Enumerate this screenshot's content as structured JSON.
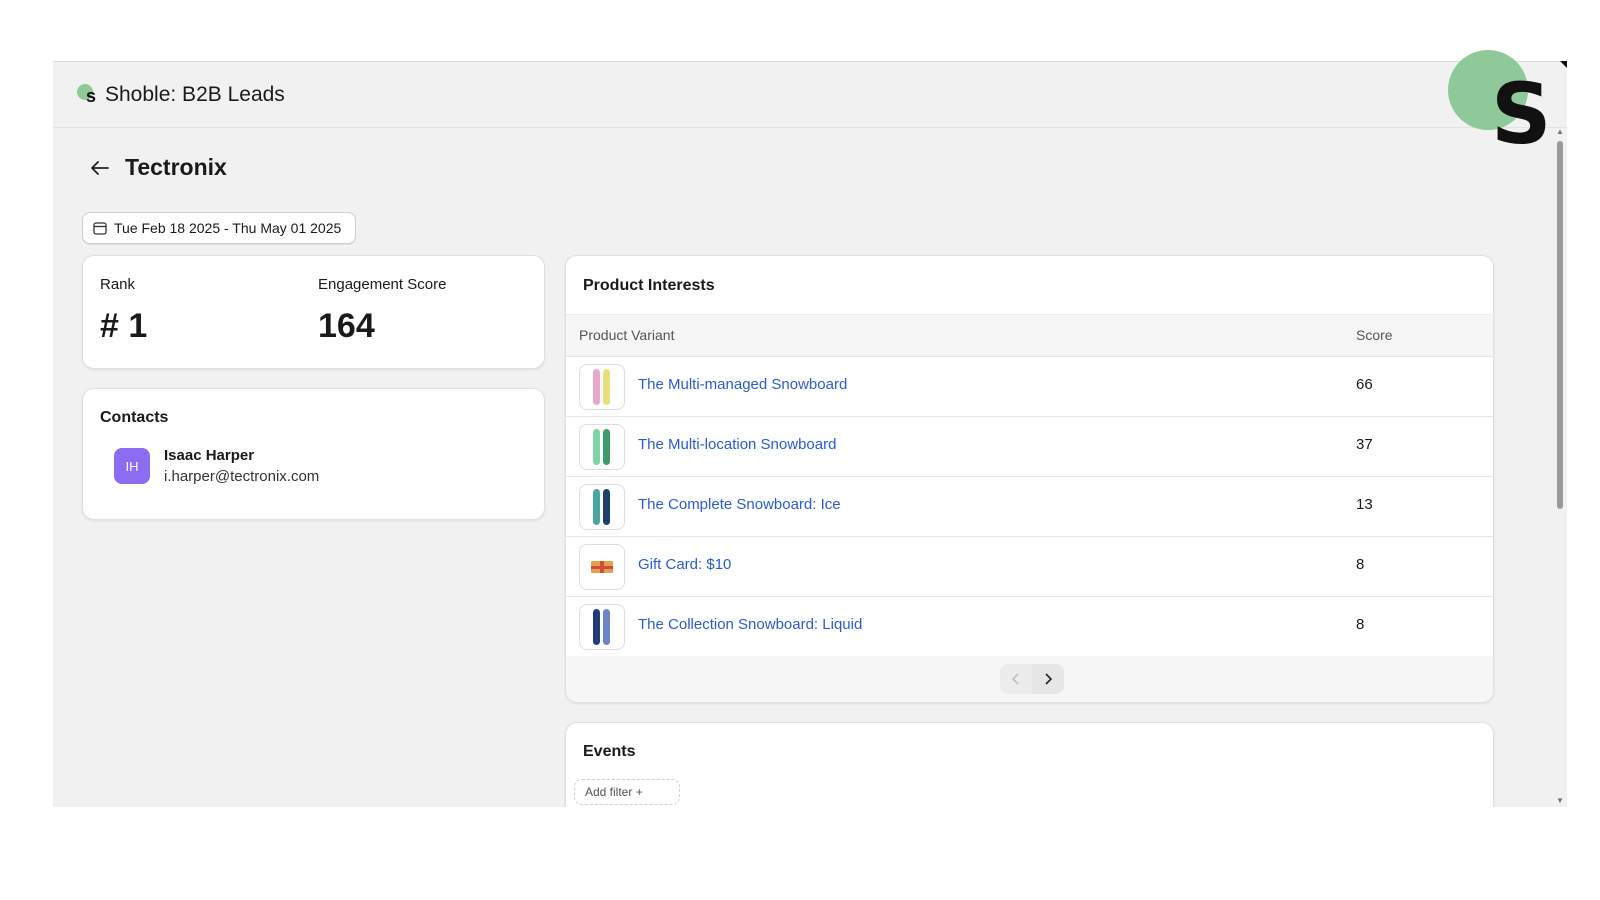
{
  "app": {
    "title": "Shoble: B2B Leads",
    "logo_letter": "s",
    "big_logo_letter": "S"
  },
  "page": {
    "title": "Tectronix"
  },
  "date_range": {
    "label": "Tue Feb 18 2025 - Thu May 01 2025"
  },
  "stats": {
    "rank_label": "Rank",
    "rank_value": "# 1",
    "engagement_label": "Engagement Score",
    "engagement_value": "164"
  },
  "contacts": {
    "title": "Contacts",
    "items": [
      {
        "initials": "IH",
        "name": "Isaac Harper",
        "email": "i.harper@tectronix.com"
      }
    ]
  },
  "products": {
    "title": "Product Interests",
    "columns": {
      "variant": "Product Variant",
      "score": "Score"
    },
    "rows": [
      {
        "name": "The Multi-managed Snowboard",
        "score": "66",
        "thumb": "snowboard-pink-yellow"
      },
      {
        "name": "The Multi-location Snowboard",
        "score": "37",
        "thumb": "snowboard-green"
      },
      {
        "name": "The Complete Snowboard: Ice",
        "score": "13",
        "thumb": "snowboard-teal-ice"
      },
      {
        "name": "Gift Card: $10",
        "score": "8",
        "thumb": "gift-card"
      },
      {
        "name": "The Collection Snowboard: Liquid",
        "score": "8",
        "thumb": "snowboard-navy"
      }
    ]
  },
  "events": {
    "title": "Events",
    "filter_label": "Add filter +"
  },
  "colors": {
    "accent_link": "#2a5bd7",
    "avatar": "#8b6cf2",
    "logo_green": "#8fc99a"
  }
}
